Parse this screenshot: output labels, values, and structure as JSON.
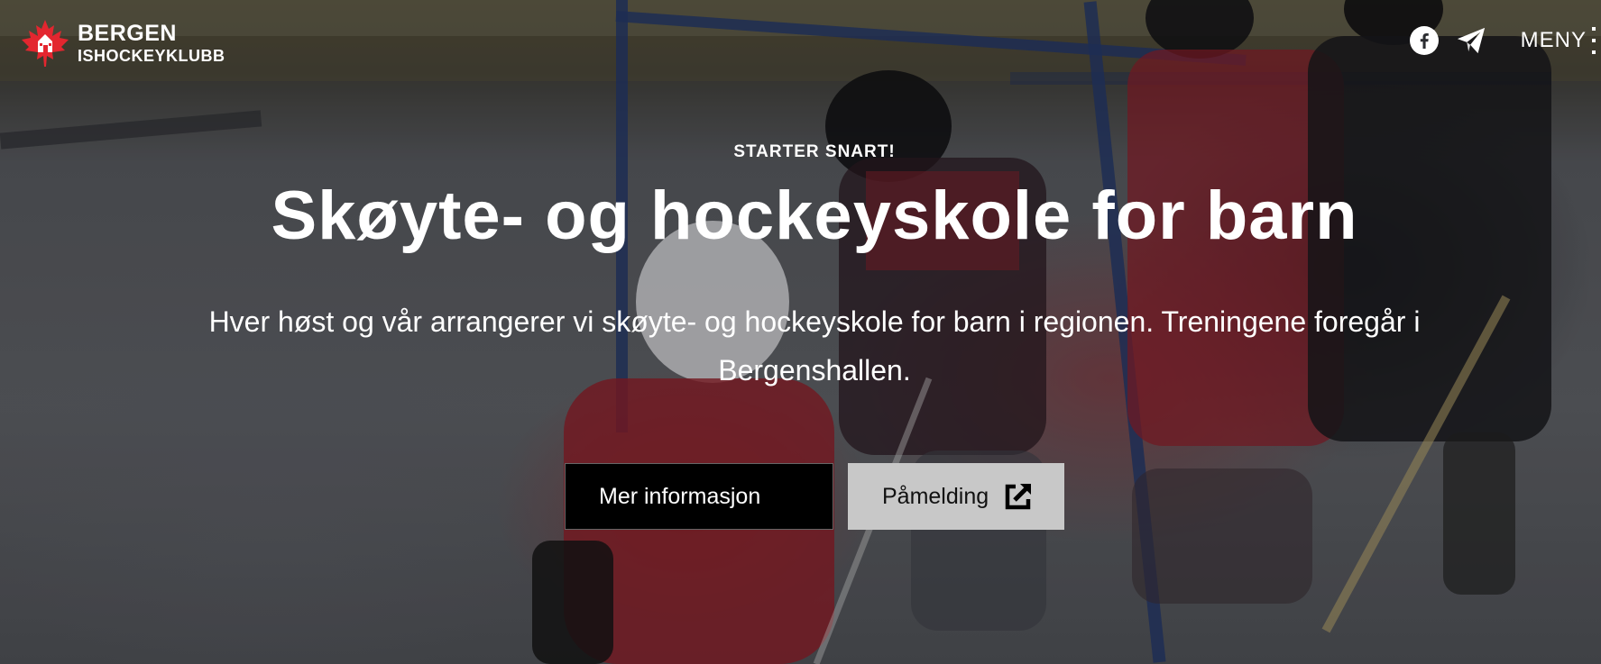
{
  "brand": {
    "line1": "BERGEN",
    "line2": "ISHOCKEYKLUBB",
    "logo_icon": "maple-leaf-logo-icon",
    "logo_color": "#e3262f"
  },
  "header": {
    "facebook_icon": "facebook-icon",
    "mail_icon": "paper-plane-icon",
    "menu_label": "MENY",
    "menu_icon": "menu-icon"
  },
  "hero": {
    "eyebrow": "STARTER SNART!",
    "title": "Skøyte- og hockeyskole for barn",
    "text": "Hver høst og vår arrangerer vi skøyte- og hockeyskole for barn i regionen. Treningene foregår i Bergenshallen.",
    "primary_button": "Mer informasjon",
    "secondary_button": "Påmelding",
    "secondary_icon": "external-link-icon"
  }
}
